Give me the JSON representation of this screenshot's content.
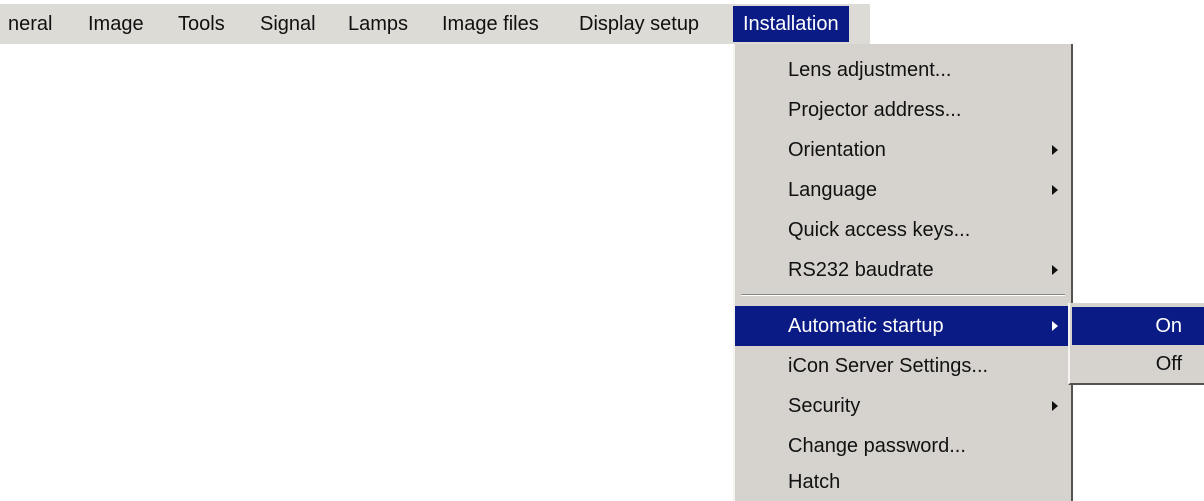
{
  "menubar": {
    "items": [
      {
        "label": "neral"
      },
      {
        "label": "Image"
      },
      {
        "label": "Tools"
      },
      {
        "label": "Signal"
      },
      {
        "label": "Lamps"
      },
      {
        "label": "Image files"
      },
      {
        "label": "Display setup"
      },
      {
        "label": "Installation",
        "active": true
      }
    ]
  },
  "installation_menu": {
    "items": [
      {
        "label": "Lens adjustment...",
        "has_submenu": false
      },
      {
        "label": "Projector address...",
        "has_submenu": false
      },
      {
        "label": "Orientation",
        "has_submenu": true
      },
      {
        "label": "Language",
        "has_submenu": true
      },
      {
        "label": "Quick access keys...",
        "has_submenu": false
      },
      {
        "label": "RS232 baudrate",
        "has_submenu": true
      },
      {
        "label": "Automatic startup",
        "has_submenu": true,
        "highlighted": true
      },
      {
        "label": "iCon Server Settings...",
        "has_submenu": false
      },
      {
        "label": "Security",
        "has_submenu": true
      },
      {
        "label": "Change password...",
        "has_submenu": false
      },
      {
        "label": "Hatch",
        "has_submenu": false
      }
    ]
  },
  "automatic_startup_submenu": {
    "items": [
      {
        "label": "On",
        "highlighted": true
      },
      {
        "label": "Off"
      }
    ]
  },
  "colors": {
    "menu_background": "#d6d3ce",
    "highlight": "#0b1b86",
    "highlight_text": "#ffffff"
  },
  "icons": {
    "submenu_arrow": "triangle-right-icon"
  }
}
